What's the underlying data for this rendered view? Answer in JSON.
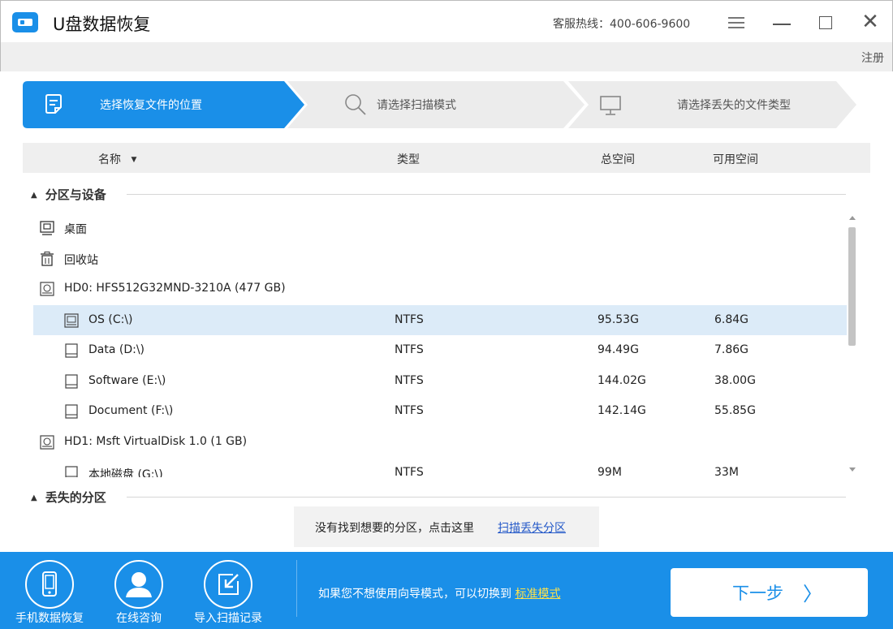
{
  "window": {
    "title": "U盘数据恢复",
    "hotline": "客服热线：400-606-9600",
    "register_label": "注册"
  },
  "steps": [
    {
      "label": "选择恢复文件的位置",
      "icon": "document-icon",
      "active": true
    },
    {
      "label": "请选择扫描模式",
      "icon": "search-icon",
      "active": false
    },
    {
      "label": "请选择丢失的文件类型",
      "icon": "monitor-icon",
      "active": false
    }
  ],
  "table": {
    "headers": {
      "name": "名称",
      "type": "类型",
      "total": "总空间",
      "free": "可用空间"
    }
  },
  "sections": {
    "partitions": "分区与设备",
    "lost": "丢失的分区"
  },
  "rows": [
    {
      "name": "桌面",
      "icon": "desktop-icon",
      "type": "",
      "total": "",
      "free": ""
    },
    {
      "name": "回收站",
      "icon": "recycle-bin-icon",
      "type": "",
      "total": "",
      "free": ""
    },
    {
      "name": "HD0: HFS512G32MND-3210A (477 GB)",
      "icon": "hard-disk-icon",
      "type": "",
      "total": "",
      "free": ""
    },
    {
      "name": "OS (C:\\)",
      "icon": "os-drive-icon",
      "type": "NTFS",
      "total": "95.53G",
      "free": "6.84G",
      "selected": true
    },
    {
      "name": "Data (D:\\)",
      "icon": "drive-icon",
      "type": "NTFS",
      "total": "94.49G",
      "free": "7.86G"
    },
    {
      "name": "Software (E:\\)",
      "icon": "drive-icon",
      "type": "NTFS",
      "total": "144.02G",
      "free": "38.00G"
    },
    {
      "name": "Document (F:\\)",
      "icon": "drive-icon",
      "type": "NTFS",
      "total": "142.14G",
      "free": "55.85G"
    },
    {
      "name": "HD1: Msft VirtualDisk 1.0 (1 GB)",
      "icon": "hard-disk-icon",
      "type": "",
      "total": "",
      "free": ""
    },
    {
      "name": "本地磁盘 (G:\\)",
      "icon": "drive-icon",
      "type": "NTFS",
      "total": "99M",
      "free": "33M"
    }
  ],
  "hint": {
    "text": "没有找到想要的分区，点击这里",
    "link": "扫描丢失分区"
  },
  "footer": {
    "buttons": [
      {
        "label": "手机数据恢复",
        "icon": "phone-icon"
      },
      {
        "label": "在线咨询",
        "icon": "user-icon"
      },
      {
        "label": "导入扫描记录",
        "icon": "import-icon"
      }
    ],
    "switch_text": "如果您不想使用向导模式，可以切换到",
    "switch_link": "标准模式",
    "next_label": "下一步",
    "next_arrow": "〉"
  },
  "colors": {
    "accent": "#1a8fe8",
    "selected_row": "#dcebf8",
    "link": "#2358c8",
    "footer_link": "#ffe24a"
  }
}
